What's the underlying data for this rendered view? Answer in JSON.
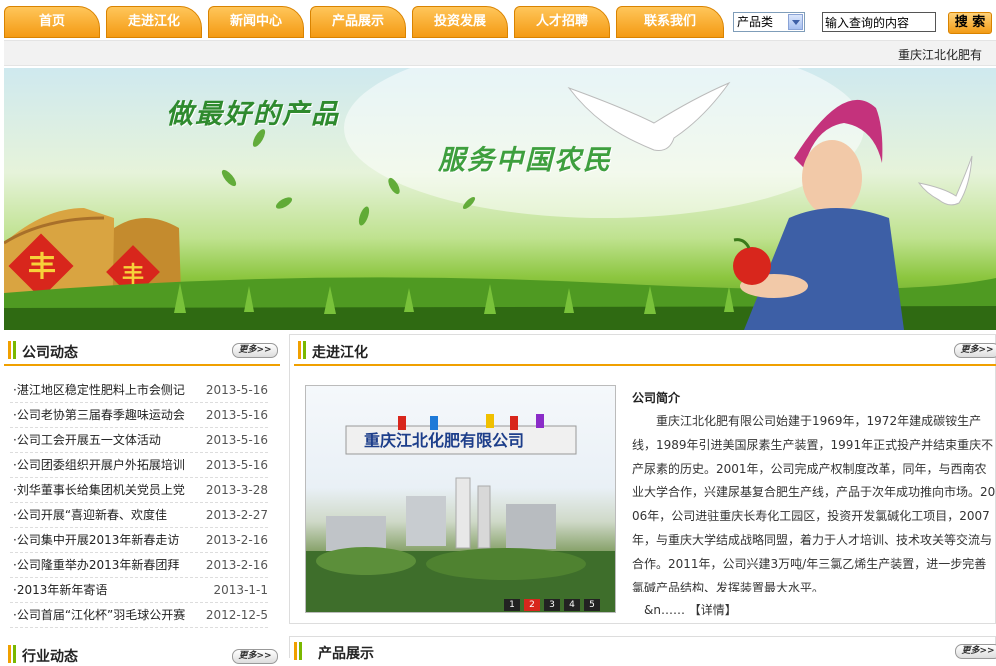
{
  "nav": {
    "items": [
      {
        "label": "首页"
      },
      {
        "label": "走进江化"
      },
      {
        "label": "新闻中心"
      },
      {
        "label": "产品展示"
      },
      {
        "label": "投资发展"
      },
      {
        "label": "人才招聘"
      },
      {
        "label": "联系我们"
      }
    ]
  },
  "search": {
    "category_selected": "产品类",
    "input_value": "输入查询的内容",
    "button_label": "搜 索"
  },
  "marquee": {
    "text": "重庆江北化肥有"
  },
  "banner": {
    "slogan1": "做最好的产品",
    "slogan2": "服务中国农民",
    "sign_char": "丰"
  },
  "company_news": {
    "title": "公司动态",
    "more_label": "更多>>",
    "items": [
      {
        "title": "·湛江地区稳定性肥料上市会侧记",
        "date": "2013-5-16"
      },
      {
        "title": "·公司老协第三届春季趣味运动会",
        "date": "2013-5-16"
      },
      {
        "title": "·公司工会开展五一文体活动",
        "date": "2013-5-16"
      },
      {
        "title": "·公司团委组织开展户外拓展培训",
        "date": "2013-5-16"
      },
      {
        "title": "·刘华董事长给集团机关党员上党",
        "date": "2013-3-28"
      },
      {
        "title": "·公司开展“喜迎新春、欢度佳",
        "date": "2013-2-27"
      },
      {
        "title": "·公司集中开展2013年新春走访",
        "date": "2013-2-16"
      },
      {
        "title": "·公司隆重举办2013年新春团拜",
        "date": "2013-2-16"
      },
      {
        "title": "·2013年新年寄语",
        "date": "2013-1-1"
      },
      {
        "title": "·公司首届“江化杯”羽毛球公开赛",
        "date": "2012-12-5"
      }
    ]
  },
  "industry_news": {
    "title": "行业动态",
    "more_label": "更多>>"
  },
  "about": {
    "section_title": "走进江化",
    "more_label": "更多>>",
    "photo_sign": "重庆江北化肥有限公司",
    "pager": [
      "1",
      "2",
      "3",
      "4",
      "5"
    ],
    "pager_active": "2",
    "intro_title": "公司简介",
    "intro_body": "重庆江北化肥有限公司始建于1969年，1972年建成碳铵生产线，1989年引进美国尿素生产装置，1991年正式投产并结束重庆不产尿素的历史。2001年，公司完成产权制度改革，同年，与西南农业大学合作，兴建尿基复合肥生产线，产品于次年成功推向市场。2006年，公司进驻重庆长寿化工园区，投资开发氯碱化工项目，2007年，与重庆大学结成战略同盟，着力于人才培训、技术攻关等交流与合作。2011年，公司兴建3万吨/年三氯乙烯生产装置，进一步完善氯碱产品结构、发挥装置最大水平。",
    "intro_more_prefix": "&n……",
    "intro_more_link": "【详情】"
  },
  "products": {
    "title": "产品展示",
    "more_label": "更多>>"
  },
  "colors": {
    "nav_orange": "#f49a13",
    "accent_green": "#7ab800",
    "banner_green": "#8cc63f"
  }
}
